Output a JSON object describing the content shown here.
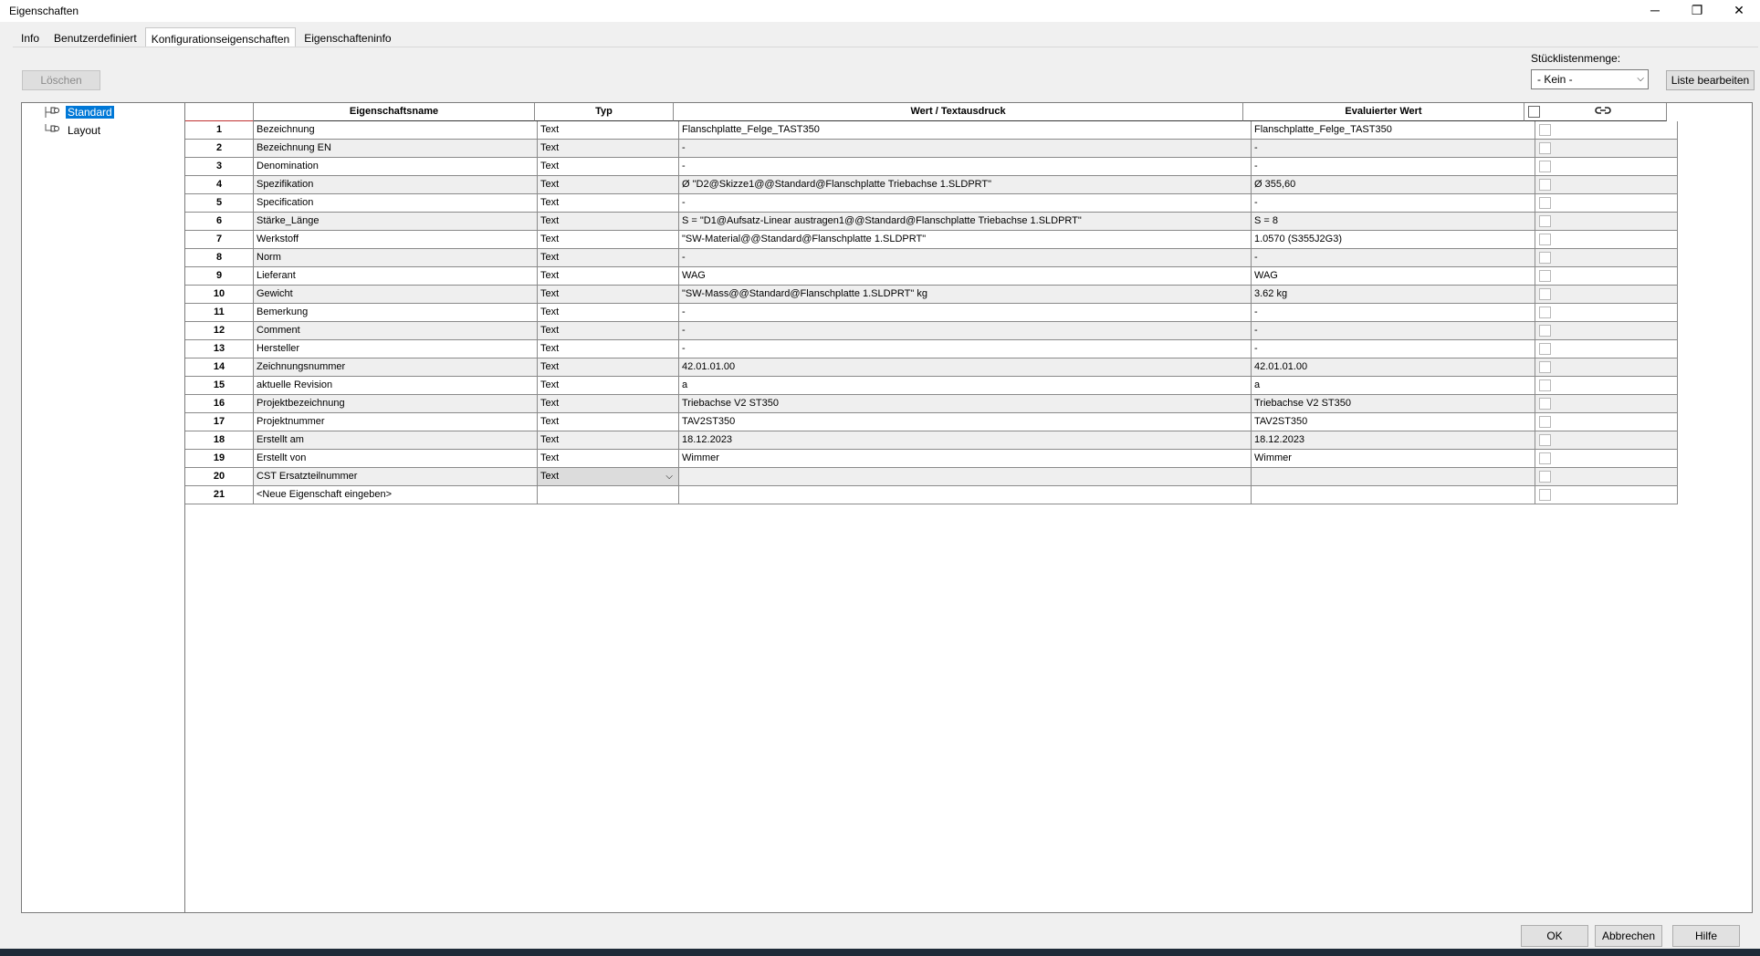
{
  "window": {
    "title": "Eigenschaften",
    "minimize": "─",
    "restore": "❐",
    "close": "✕"
  },
  "tabs": [
    {
      "label": "Info"
    },
    {
      "label": "Benutzerdefiniert"
    },
    {
      "label": "Konfigurationseigenschaften"
    },
    {
      "label": "Eigenschafteninfo"
    }
  ],
  "active_tab": 2,
  "toolbar": {
    "delete_label": "Löschen",
    "quantity_label": "Stücklistenmenge:",
    "quantity_value": "- Kein -",
    "edit_list_label": "Liste bearbeiten"
  },
  "tree": {
    "items": [
      {
        "label": "Standard",
        "selected": true
      },
      {
        "label": "Layout",
        "selected": false
      }
    ]
  },
  "grid": {
    "headers": {
      "num": "",
      "name": "Eigenschaftsname",
      "type": "Typ",
      "value": "Wert / Textausdruck",
      "evaluated": "Evaluierter Wert"
    },
    "rows": [
      {
        "num": "1",
        "name": "Bezeichnung",
        "type": "Text",
        "value": "Flanschplatte_Felge_TAST350",
        "evaluated": "Flanschplatte_Felge_TAST350"
      },
      {
        "num": "2",
        "name": "Bezeichnung EN",
        "type": "Text",
        "value": "-",
        "evaluated": "-"
      },
      {
        "num": "3",
        "name": "Denomination",
        "type": "Text",
        "value": "-",
        "evaluated": "-"
      },
      {
        "num": "4",
        "name": "Spezifikation",
        "type": "Text",
        "value": "Ø \"D2@Skizze1@@Standard@Flanschplatte Triebachse  1.SLDPRT\"",
        "evaluated": "Ø 355,60"
      },
      {
        "num": "5",
        "name": "Specification",
        "type": "Text",
        "value": "-",
        "evaluated": "-"
      },
      {
        "num": "6",
        "name": "Stärke_Länge",
        "type": "Text",
        "value": "S = \"D1@Aufsatz-Linear austragen1@@Standard@Flanschplatte Triebachse  1.SLDPRT\"",
        "evaluated": "S = 8"
      },
      {
        "num": "7",
        "name": "Werkstoff",
        "type": "Text",
        "value": "\"SW-Material@@Standard@Flanschplatte 1.SLDPRT\"",
        "evaluated": "1.0570 (S355J2G3)"
      },
      {
        "num": "8",
        "name": "Norm",
        "type": "Text",
        "value": "-",
        "evaluated": "-"
      },
      {
        "num": "9",
        "name": "Lieferant",
        "type": "Text",
        "value": "WAG",
        "evaluated": "WAG"
      },
      {
        "num": "10",
        "name": "Gewicht",
        "type": "Text",
        "value": "\"SW-Mass@@Standard@Flanschplatte 1.SLDPRT\" kg",
        "evaluated": "3.62 kg"
      },
      {
        "num": "11",
        "name": "Bemerkung",
        "type": "Text",
        "value": "-",
        "evaluated": "-"
      },
      {
        "num": "12",
        "name": "Comment",
        "type": "Text",
        "value": "-",
        "evaluated": "-"
      },
      {
        "num": "13",
        "name": "Hersteller",
        "type": "Text",
        "value": "-",
        "evaluated": "-"
      },
      {
        "num": "14",
        "name": "Zeichnungsnummer",
        "type": "Text",
        "value": "42.01.01.00",
        "evaluated": "42.01.01.00"
      },
      {
        "num": "15",
        "name": "aktuelle Revision",
        "type": "Text",
        "value": "a",
        "evaluated": "a"
      },
      {
        "num": "16",
        "name": "Projektbezeichnung",
        "type": "Text",
        "value": "Triebachse V2 ST350",
        "evaluated": "Triebachse V2 ST350"
      },
      {
        "num": "17",
        "name": "Projektnummer",
        "type": "Text",
        "value": "TAV2ST350",
        "evaluated": "TAV2ST350"
      },
      {
        "num": "18",
        "name": "Erstellt am",
        "type": "Text",
        "value": "18.12.2023",
        "evaluated": "18.12.2023"
      },
      {
        "num": "19",
        "name": "Erstellt von",
        "type": "Text",
        "value": "Wimmer",
        "evaluated": "Wimmer"
      },
      {
        "num": "20",
        "name": "CST Ersatzteilnummer",
        "type": "Text",
        "value": "",
        "evaluated": "",
        "editing": true
      },
      {
        "num": "21",
        "name": "<Neue Eigenschaft eingeben>",
        "type": "",
        "value": "",
        "evaluated": ""
      }
    ]
  },
  "footer": {
    "ok_label": "OK",
    "cancel_label": "Abbrechen",
    "help_label": "Hilfe"
  }
}
